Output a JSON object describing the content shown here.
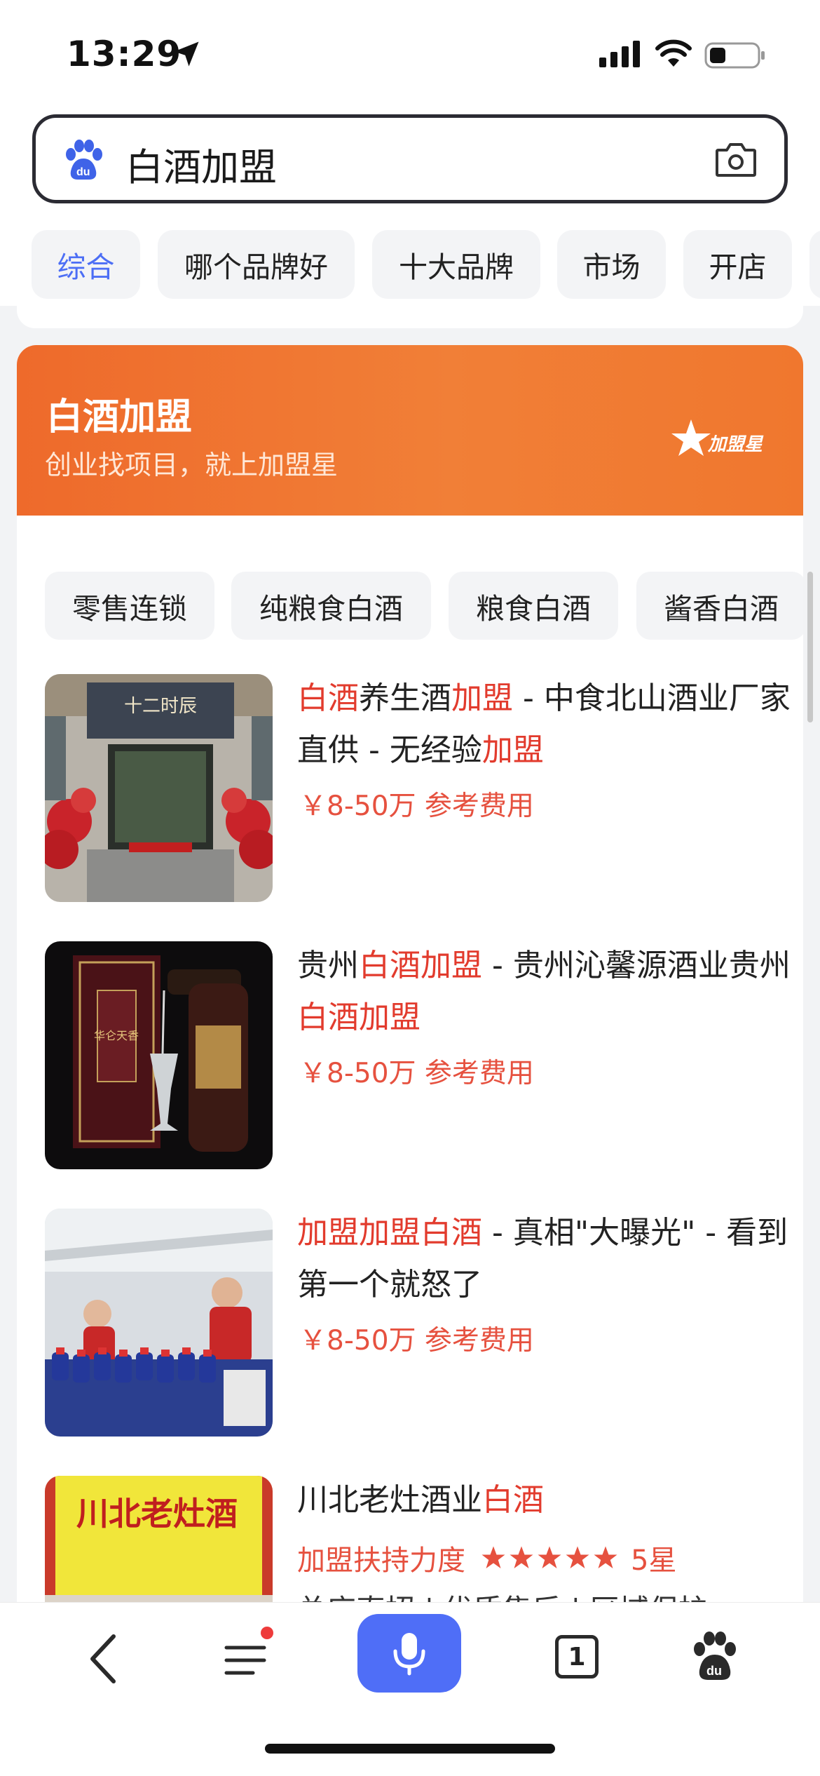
{
  "status_bar": {
    "time": "13:29"
  },
  "search": {
    "query": "白酒加盟"
  },
  "tabs": [
    "综合",
    "哪个品牌好",
    "十大品牌",
    "市场",
    "开店"
  ],
  "banner": {
    "title": "白酒加盟",
    "subtitle": "创业找项目，就上加盟星",
    "logo_text": "加盟星"
  },
  "chips": [
    "零售连锁",
    "纯粮食白酒",
    "粮食白酒",
    "酱香白酒"
  ],
  "results": [
    {
      "title_parts": [
        {
          "text": "白酒",
          "hl": true
        },
        {
          "text": "养生酒",
          "hl": false
        },
        {
          "text": "加盟",
          "hl": true
        },
        {
          "text": " - 中食北山酒业厂家直供 - 无经验",
          "hl": false
        },
        {
          "text": "加盟",
          "hl": true
        }
      ],
      "price": "￥8-50万 参考费用",
      "image_sign": "十二时辰"
    },
    {
      "title_parts": [
        {
          "text": "贵州",
          "hl": false
        },
        {
          "text": "白酒加盟",
          "hl": true
        },
        {
          "text": " - 贵州沁馨源酒业贵州",
          "hl": false
        },
        {
          "text": "白酒加盟",
          "hl": true
        }
      ],
      "price": "￥8-50万 参考费用",
      "image_sign": "华仑天香"
    },
    {
      "title_parts": [
        {
          "text": "加盟加盟白酒",
          "hl": true
        },
        {
          "text": " - 真相\"大曝光\" - 看到第一个就怒了",
          "hl": false
        }
      ],
      "price": "￥8-50万 参考费用"
    },
    {
      "title_parts": [
        {
          "text": "川北老灶酒业",
          "hl": false
        },
        {
          "text": "白酒",
          "hl": true
        }
      ],
      "rating_label": "加盟扶持力度",
      "rating_stars": 5,
      "rating_text": "5星",
      "extra": "总店直招 | 优质售后 | 区域保护",
      "image_sign": "川北老灶酒"
    }
  ],
  "bottom_nav": {
    "tab_count": "1"
  },
  "colors": {
    "accent": "#4f6ef7",
    "highlight": "#e23b2d",
    "banner": "#ef6f2e"
  }
}
